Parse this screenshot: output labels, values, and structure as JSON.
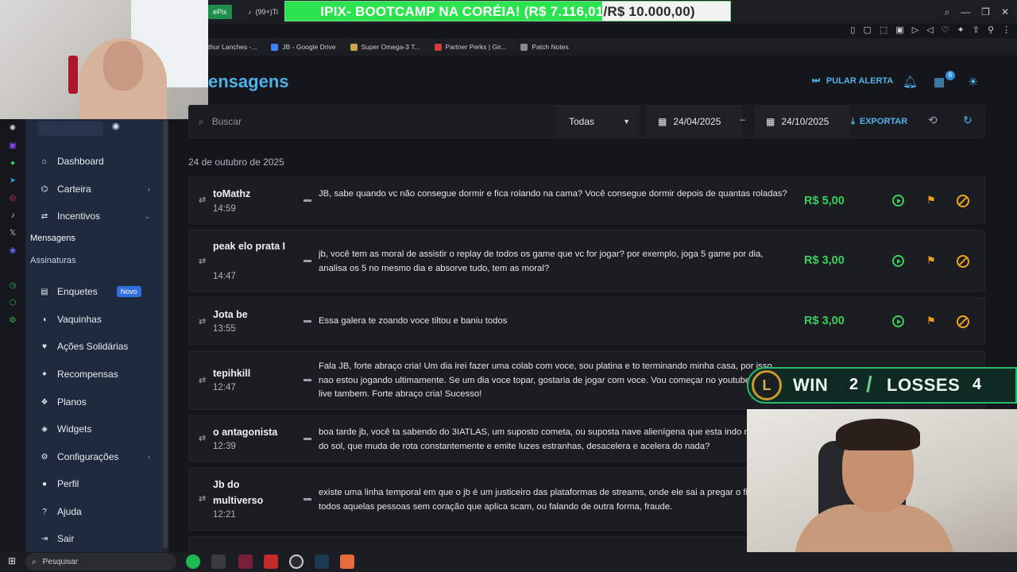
{
  "browser": {
    "tabs": [
      {
        "label": "ePix",
        "active": true
      },
      {
        "label": "(99+)Ti",
        "active": false
      }
    ],
    "donation_banner": {
      "text": "IPIX- BOOTCAMP NA CORÉIA! (R$ 7.116,01",
      "goal_text": "/R$ 10.000,00)",
      "progress": 0.7116,
      "color": "#2be34f"
    },
    "bookmarks": [
      {
        "label": "thur Lanches -...",
        "color": "#d07b2a"
      },
      {
        "label": "JB - Google Drive",
        "color": "#3b82f6"
      },
      {
        "label": "Super Omega-3 T...",
        "color": "#c9a34a"
      },
      {
        "label": "Partner Perks | Gir...",
        "color": "#d43a3a"
      },
      {
        "label": "Patch Notes",
        "color": "#888888"
      }
    ]
  },
  "sidebar": {
    "items": [
      {
        "label": "Dashboard",
        "icon": "home-icon"
      },
      {
        "label": "Carteira",
        "icon": "bank-icon",
        "has_chevron": true
      },
      {
        "label": "Incentivos",
        "icon": "arrows-icon",
        "expanded": true
      },
      {
        "label": "Enquetes",
        "icon": "poll-icon",
        "badge": "Novo"
      },
      {
        "label": "Vaquinhas",
        "icon": "piggy-icon"
      },
      {
        "label": "Ações Solidárias",
        "icon": "heart-hands-icon"
      },
      {
        "label": "Recompensas",
        "icon": "gift-icon"
      },
      {
        "label": "Planos",
        "icon": "plans-icon"
      },
      {
        "label": "Widgets",
        "icon": "widget-icon"
      },
      {
        "label": "Configurações",
        "icon": "gear-icon",
        "has_chevron": true
      },
      {
        "label": "Perfil",
        "icon": "user-icon"
      },
      {
        "label": "Ajuda",
        "icon": "help-icon"
      },
      {
        "label": "Sair",
        "icon": "logout-icon"
      }
    ],
    "subitems": [
      {
        "label": "Mensagens",
        "active": true
      },
      {
        "label": "Assinaturas",
        "active": false
      }
    ]
  },
  "header": {
    "title": "ensagens",
    "skip_alert_label": "PULAR ALERTA",
    "cart_count": "6"
  },
  "filters": {
    "search_placeholder": "Buscar",
    "select_value": "Todas",
    "date_from": "24/04/2025",
    "date_sep": "–",
    "date_to": "24/10/2025",
    "export_label": "EXPORTAR"
  },
  "date_heading": "24 de outubro de 2025",
  "messages": [
    {
      "user": "toMathz",
      "time": "14:59",
      "text": "JB, sabe quando vc não consegue dormir e fica rolando na cama? Você consegue dormir depois de quantas roladas?",
      "amount": "R$ 5,00"
    },
    {
      "user": "peak elo prata I",
      "time": "14:47",
      "text": "jb, você tem as moral de assistir o replay de todos os game que vc for jogar? por exemplo, joga 5 game por dia, analisa os 5 no mesmo dia e absorve tudo, tem as moral?",
      "amount": "R$ 3,00"
    },
    {
      "user": "Jota be",
      "time": "13:55",
      "text": "Essa galera te zoando voce tiltou e baniu todos",
      "amount": "R$ 3,00"
    },
    {
      "user": "tepihkill",
      "time": "12:47",
      "text": "Fala JB, forte abraço cria! Um dia irei fazer uma colab com voce, sou platina e to terminando minha casa, por isso nao estou jogando ultimamente. Se um dia voce topar, gostaria de jogar com voce. Vou começar no youtube e faço live tambem. Forte abraço cria! Sucesso!",
      "amount": ""
    },
    {
      "user": "o antagonista",
      "time": "12:39",
      "text": "boa tarde jb, você ta sabendo do 3IATLAS, um suposto cometa, ou suposta nave alienígena que esta indo na direção do sol, que muda de rota constantemente e emite luzes estranhas, desacelera e acelera do nada?",
      "amount": ""
    },
    {
      "user": "Jb do multiverso",
      "time": "12:21",
      "text": "existe uma linha temporal em que o jb é um justiceiro das plataformas de streams, onde ele sai a pregar o fim de todos aquelas pessoas sem coração que aplica scam, ou falando de outra forma, fraude.",
      "amount": ""
    }
  ],
  "overlay": {
    "win_label": "WIN",
    "wins": "2",
    "loss_label": "LOSSES",
    "losses": "4"
  },
  "taskbar": {
    "search_label": "Pesquisar"
  },
  "colors": {
    "accent": "#4fb1e8",
    "sidebar_bg": "#1f2a3e",
    "amount_green": "#3ad05a",
    "flag_orange": "#f0a21a"
  }
}
